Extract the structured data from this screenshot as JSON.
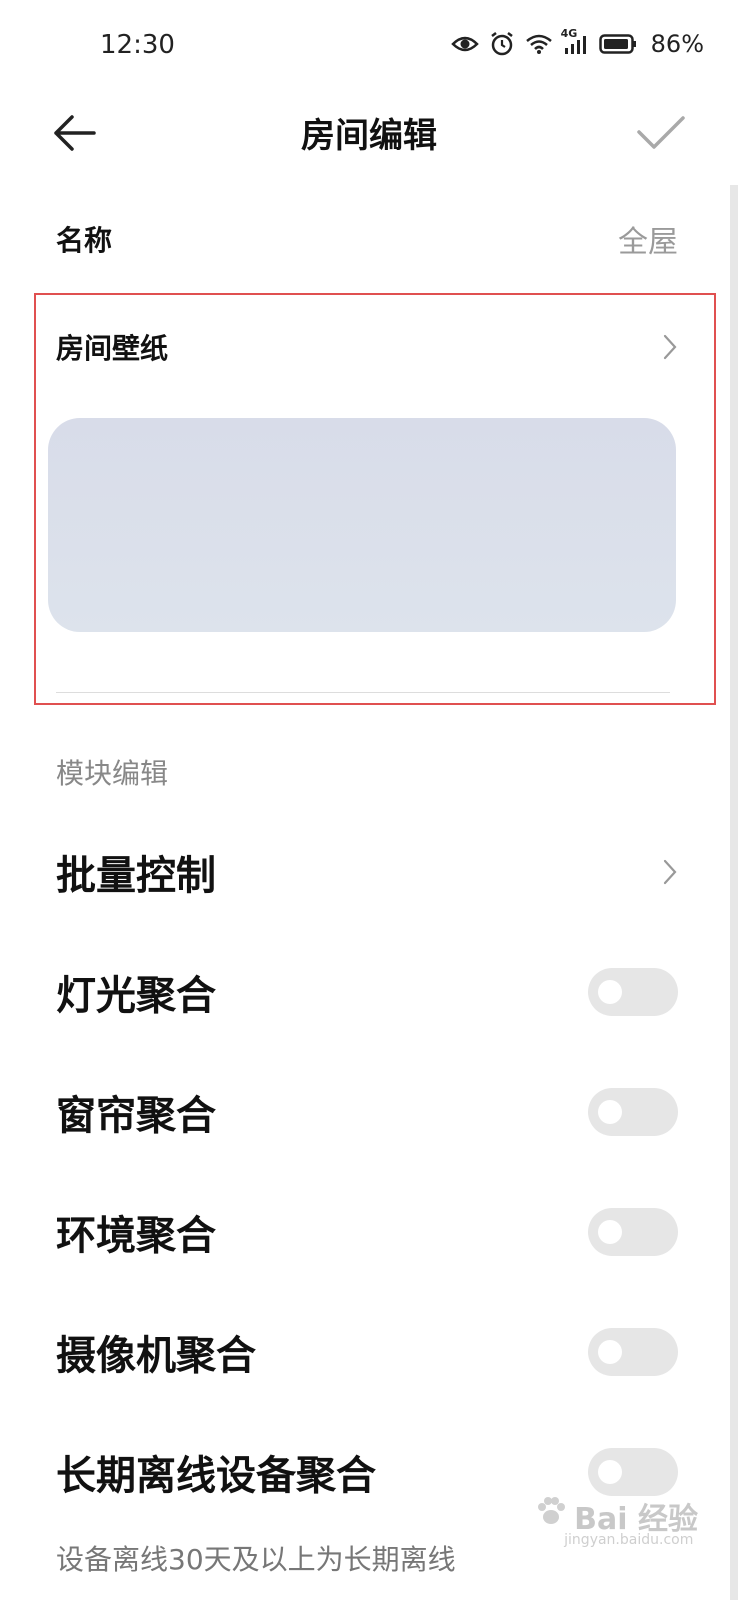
{
  "status_bar": {
    "time": "12:30",
    "network": "4G",
    "battery": "86%"
  },
  "header": {
    "title": "房间编辑"
  },
  "name_row": {
    "label": "名称",
    "value": "全屋"
  },
  "wallpaper_row": {
    "label": "房间壁纸"
  },
  "module_section": {
    "label": "模块编辑",
    "items": [
      {
        "label": "批量控制",
        "control": "chevron"
      },
      {
        "label": "灯光聚合",
        "control": "toggle",
        "on": false
      },
      {
        "label": "窗帘聚合",
        "control": "toggle",
        "on": false
      },
      {
        "label": "环境聚合",
        "control": "toggle",
        "on": false
      },
      {
        "label": "摄像机聚合",
        "control": "toggle",
        "on": false
      },
      {
        "label": "长期离线设备聚合",
        "control": "toggle",
        "on": false
      }
    ]
  },
  "footer_note": "设备离线30天及以上为长期离线",
  "watermark": {
    "text": "Bai 经验",
    "sub": "jingyan.baidu.com"
  },
  "colors": {
    "highlight": "#e05050",
    "toggle_off": "#e6e6e6"
  }
}
